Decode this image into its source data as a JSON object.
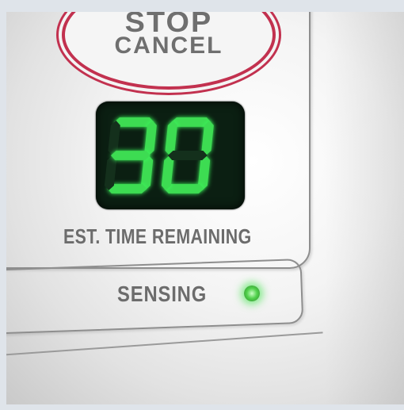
{
  "panel": {
    "stop_line1": "STOP",
    "stop_line2": "CANCEL",
    "display_value": "30",
    "est_time_label": "EST. TIME REMAINING",
    "sensing_label": "SENSING"
  },
  "colors": {
    "button_ring": "#c2314f",
    "display_bg": "#0b1f12",
    "digit_on": "#3ddc52",
    "indicator": "#52d24d"
  },
  "icons": {
    "sensing_indicator": "green-led-icon"
  }
}
